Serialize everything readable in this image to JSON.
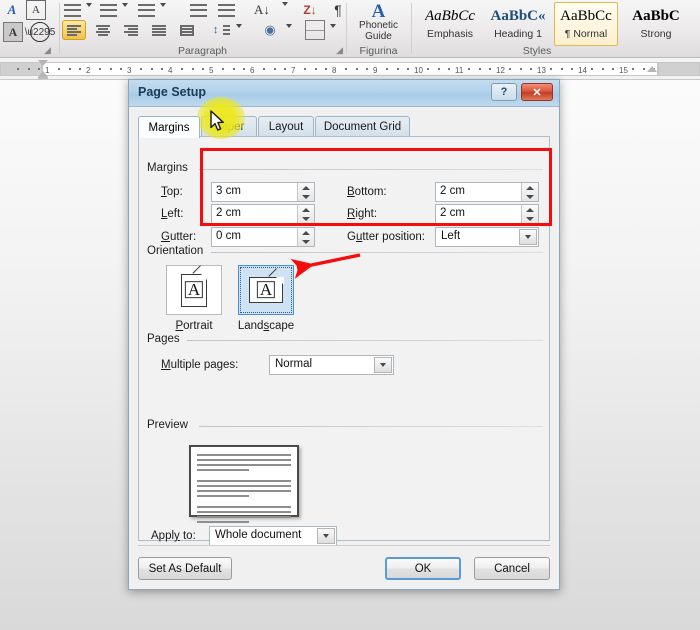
{
  "ribbon": {
    "groups": [
      {
        "label": "Paragraph"
      },
      {
        "label": "Figurina"
      },
      {
        "label": "Styles"
      }
    ],
    "font_group_icons": [
      "text-effects-icon",
      "character-border-icon",
      "character-shading-icon",
      "enclose-characters-icon"
    ],
    "paragraph_icons": [
      "bullets-icon",
      "numbering-icon",
      "multilevel-list-icon",
      "decrease-indent-icon",
      "increase-indent-icon",
      "sort-icon",
      "show-formatting-marks-icon",
      "align-left-icon",
      "align-center-icon",
      "align-right-icon",
      "justify-icon",
      "distributed-icon",
      "line-spacing-icon",
      "shading-icon",
      "borders-icon"
    ],
    "phonetic_guide": {
      "glyph": "A",
      "line1": "Phonetic",
      "line2": "Guide"
    },
    "styles": [
      {
        "sample": "AaBbCc",
        "name": "Emphasis",
        "selected": false
      },
      {
        "sample": "AaBbC«",
        "name": "Heading 1",
        "selected": false
      },
      {
        "sample": "AaBbCc",
        "name": "¶ Normal",
        "selected": true
      },
      {
        "sample": "AaBbC",
        "name": "Strong",
        "selected": false
      }
    ]
  },
  "ruler": {
    "unit_labels": [
      "1",
      "2",
      "3",
      "4",
      "5",
      "6",
      "7",
      "8",
      "9",
      "10",
      "11",
      "12",
      "13",
      "14",
      "15"
    ]
  },
  "dialog": {
    "title": "Page Setup",
    "titlebar_buttons": {
      "help_label": "?",
      "help_icon": "help-icon",
      "close_label": "✕",
      "close_icon": "close-icon"
    },
    "tabs": [
      {
        "label": "Margins",
        "active": true
      },
      {
        "label": "Paper",
        "active": false
      },
      {
        "label": "Layout",
        "active": false
      },
      {
        "label": "Document Grid",
        "active": false
      }
    ],
    "margins_group": {
      "title": "Margins",
      "fields": [
        {
          "label": "Top:",
          "underline": "T",
          "value": "3 cm",
          "control": "spinner"
        },
        {
          "label": "Left:",
          "underline": "L",
          "value": "2 cm",
          "control": "spinner"
        },
        {
          "label": "Gutter:",
          "underline": "G",
          "value": "0 cm",
          "control": "spinner"
        },
        {
          "label": "Bottom:",
          "underline": "B",
          "value": "2 cm",
          "control": "spinner"
        },
        {
          "label": "Right:",
          "underline": "R",
          "value": "2 cm",
          "control": "spinner"
        },
        {
          "label": "Gutter position:",
          "underline": "u",
          "value": "Left",
          "control": "combo"
        }
      ]
    },
    "orientation_group": {
      "title": "Orientation",
      "options": [
        {
          "label": "Portrait",
          "selected": false
        },
        {
          "label": "Landscape",
          "selected": true
        }
      ],
      "glyph": "A"
    },
    "pages_group": {
      "title": "Pages",
      "multiple_pages_label": "Multiple pages:",
      "multiple_pages_value": "Normal"
    },
    "preview_group": {
      "title": "Preview"
    },
    "apply_to": {
      "label": "Apply to:",
      "value": "Whole document"
    },
    "footer_buttons": [
      {
        "label": "Set As Default",
        "default": false
      },
      {
        "label": "OK",
        "default": true
      },
      {
        "label": "Cancel",
        "default": false
      }
    ]
  },
  "annotations": {
    "margins_highlight_box": "red-rectangle",
    "landscape_arrow": "red-arrow-pointing-left",
    "paper_tab_highlight": "yellow-cursor-highlight",
    "colors": {
      "annotation_red": "#f50c0c",
      "cursor_highlight_yellow": "#ece81a",
      "accent_blue": "#5b9bd5",
      "selection_blue": "#cfe2f3"
    }
  }
}
